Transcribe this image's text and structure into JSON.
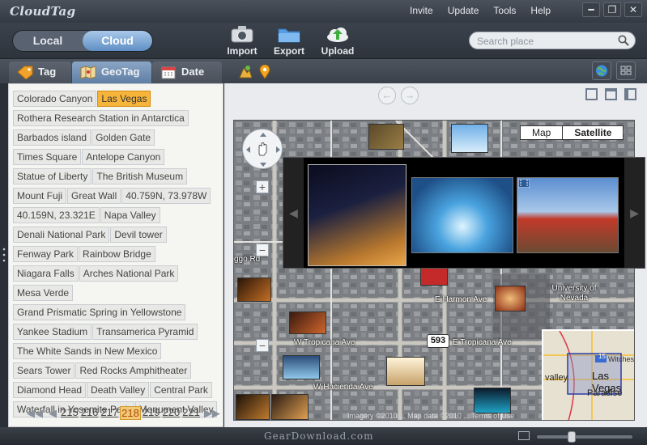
{
  "app": {
    "title": "CloudTag"
  },
  "menu": [
    "Invite",
    "Update",
    "Tools",
    "Help"
  ],
  "window_controls": {
    "minimize": "━",
    "restore": "❐",
    "close": "✕"
  },
  "toggle": {
    "local": "Local",
    "cloud": "Cloud",
    "active": "Cloud"
  },
  "toolbar": {
    "import": "Import",
    "export": "Export",
    "upload": "Upload"
  },
  "search": {
    "placeholder": "Search place",
    "value": ""
  },
  "tabs": {
    "tag": "Tag",
    "geotag": "GeoTag",
    "date": "Date",
    "active": "GeoTag"
  },
  "geotags": [
    "Colorado Canyon",
    "Las Vegas",
    "Rothera Research Station in Antarctica",
    "Barbados island",
    "Golden Gate",
    "Times Square",
    "Antelope Canyon",
    "Statue of Liberty",
    "The British Museum",
    "Mount Fuji",
    "Great Wall",
    "40.759N, 73.978W",
    "40.159N, 23.321E",
    "Napa Valley",
    "Denali National Park",
    "Devil tower",
    "Fenway Park",
    "Rainbow Bridge",
    "Niagara Falls",
    "Arches National Park",
    "Mesa Verde",
    "Grand Prismatic Spring in Yellowstone",
    "Yankee Stadium",
    "Transamerica Pyramid",
    "The White Sands in New Mexico",
    "Sears Tower",
    "Red Rocks Amphitheater",
    "Diamond Head",
    "Death Valley",
    "Central Park",
    "Waterfall in Yosemite Park",
    "Monument Valley"
  ],
  "selected_tag": "Las Vegas",
  "pager": {
    "pages": [
      "215",
      "216",
      "217",
      "218",
      "219",
      "220",
      "221"
    ],
    "current": "218"
  },
  "map": {
    "type_buttons": {
      "map": "Map",
      "satellite": "Satellite"
    },
    "active_type": "Satellite",
    "streets": {
      "harmon": "E Harmon Ave",
      "tropicana_w": "W Tropicana Ave",
      "tropicana_e": "E Tropicana Ave",
      "hacienda": "W Hacienda Ave",
      "ggo": "ggo Rd",
      "university": "University of Nevada",
      "route": "593"
    },
    "copyright": "Imagery ©2010 ... Map data ©2010 ... Terms of Use",
    "minimap": {
      "place": "Las Vegas",
      "paradise": "Paradise",
      "valley": "valley",
      "witches": "Witches",
      "route": "15"
    }
  },
  "status": {
    "watermark": "GearDownload.com",
    "zoom_level": 0.35
  },
  "colors": {
    "selected_tag": "#f6b43a",
    "active_toggle": "#6f9acb",
    "active_tab": "#7392b6"
  }
}
